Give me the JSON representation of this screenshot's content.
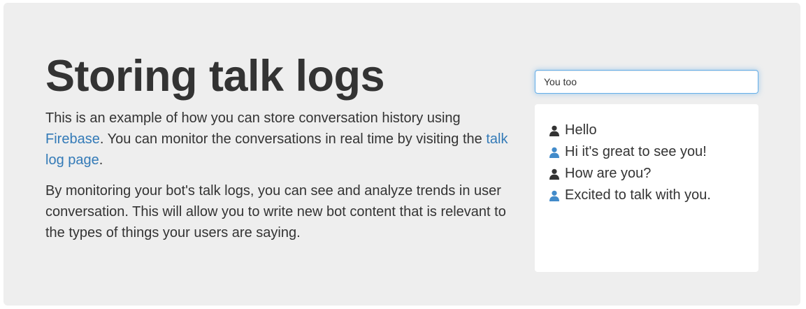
{
  "header": {
    "title": "Storing talk logs"
  },
  "intro": {
    "part1": "This is an example of how you can store conversation history using ",
    "firebase_link": "Firebase",
    "part2": ". You can monitor the conversations in real time by visiting the ",
    "talk_log_link": "talk log page",
    "part3": "."
  },
  "description": "By monitoring your bot's talk logs, you can see and analyze trends in user conversation. This will allow you to write new bot content that is relevant to the types of things your users are saying.",
  "chat": {
    "input_value": "You too",
    "messages": [
      {
        "speaker": "user",
        "icon": "user-icon",
        "color": "#333333",
        "text": "Hello"
      },
      {
        "speaker": "bot",
        "icon": "user-icon",
        "color": "#428bca",
        "text": "Hi it's great to see you!"
      },
      {
        "speaker": "user",
        "icon": "user-icon",
        "color": "#333333",
        "text": "How are you?"
      },
      {
        "speaker": "bot",
        "icon": "user-icon",
        "color": "#428bca",
        "text": "Excited to talk with you."
      }
    ]
  },
  "colors": {
    "link": "#337ab7",
    "user_icon": "#333333",
    "bot_icon": "#428bca",
    "jumbotron_bg": "#eeeeee"
  }
}
